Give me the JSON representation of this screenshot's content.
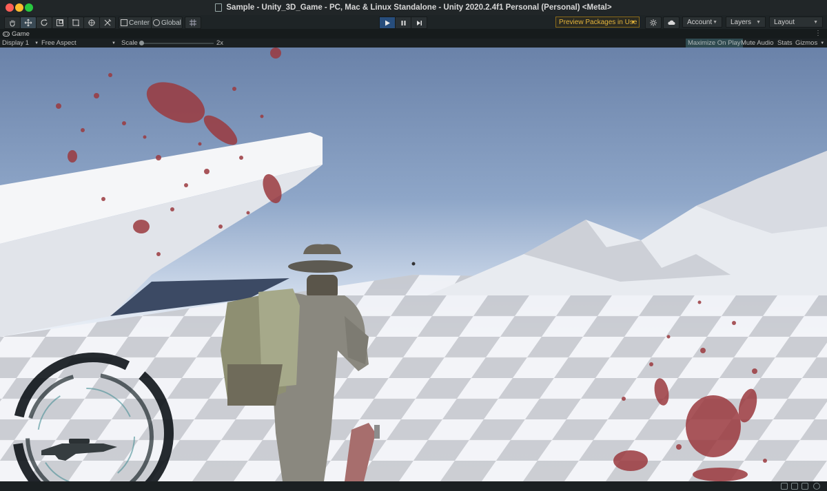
{
  "window": {
    "title": "Sample - Unity_3D_Game - PC, Mac & Linux Standalone - Unity 2020.2.4f1 Personal (Personal) <Metal>"
  },
  "toolbar": {
    "transform_tools": [
      "hand-icon",
      "move-icon",
      "rotate-icon",
      "scale-icon",
      "rect-icon",
      "transform-icon",
      "custom-tool-icon"
    ],
    "pivot_mode": "Center",
    "pivot_rotation": "Global",
    "grid_snap_icon": "grid-snap-icon",
    "play_controls": [
      "play-icon",
      "pause-icon",
      "step-icon"
    ],
    "preview_packages": "Preview Packages in Use",
    "account": "Account",
    "layers": "Layers",
    "layout": "Layout",
    "accent_color": "#e4b43b",
    "play_active_color": "#274d7c"
  },
  "game_tab": {
    "label": "Game"
  },
  "game_bar": {
    "display": "Display 1",
    "aspect": "Free Aspect",
    "scale_label": "Scale",
    "scale_value": "2x",
    "maximize_on_play": "Maximize On Play",
    "mute_audio": "Mute Audio",
    "stats": "Stats",
    "gizmos": "Gizmos"
  },
  "scene": {
    "sky_color": "#6e86ad",
    "horizon_color": "#e6edf6",
    "blood_color": "#9b3a3f",
    "hud_weapon": "sniper-rifle-icon",
    "character": "cowboy-soldier-with-backpack"
  }
}
